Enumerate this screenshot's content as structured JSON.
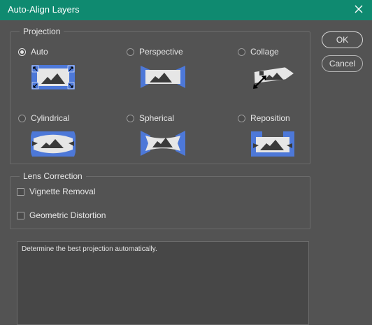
{
  "window": {
    "title": "Auto-Align Layers"
  },
  "projection": {
    "legend": "Projection",
    "options": [
      {
        "label": "Auto",
        "checked": true
      },
      {
        "label": "Perspective",
        "checked": false
      },
      {
        "label": "Collage",
        "checked": false
      },
      {
        "label": "Cylindrical",
        "checked": false
      },
      {
        "label": "Spherical",
        "checked": false
      },
      {
        "label": "Reposition",
        "checked": false
      }
    ]
  },
  "lens": {
    "legend": "Lens Correction",
    "vignette": "Vignette Removal",
    "geometric": "Geometric Distortion"
  },
  "buttons": {
    "ok": "OK",
    "cancel": "Cancel"
  },
  "description": "Determine the best projection automatically.",
  "colors": {
    "titlebar": "#0f8a70",
    "panel": "#535353",
    "accent": "#4d78d8"
  }
}
